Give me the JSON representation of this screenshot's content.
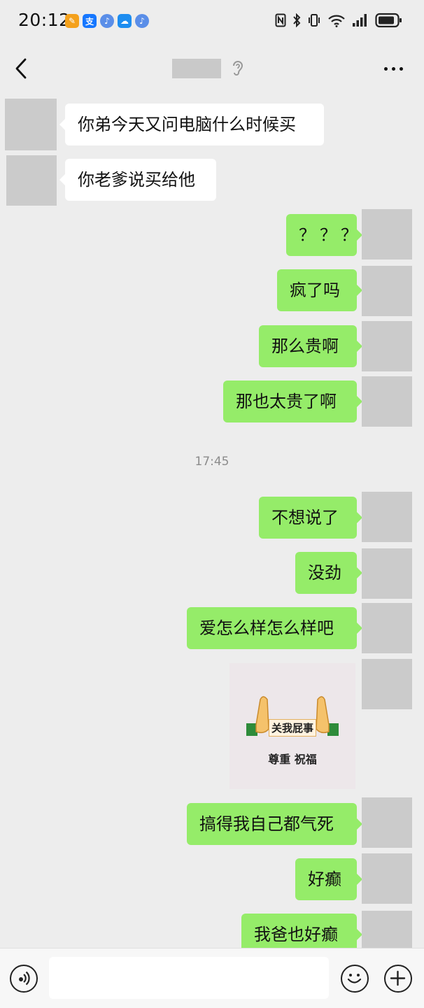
{
  "status_bar": {
    "time": "20:12",
    "app_icons": [
      "notes-app-icon",
      "alipay-icon",
      "music-app-icon",
      "weather-app-icon",
      "music-app-icon-2"
    ],
    "right_icons": [
      "nfc-icon",
      "bluetooth-icon",
      "vibrate-icon",
      "wifi-icon",
      "signal-icon",
      "battery-icon"
    ]
  },
  "header": {
    "back_icon": "chevron-left-icon",
    "listen_icon": "ear-icon",
    "more_icon": "more-horizontal-icon"
  },
  "messages": [
    {
      "side": "in",
      "text": "你弟今天又问电脑什么时候买"
    },
    {
      "side": "in",
      "text": "你老爹说买给他"
    },
    {
      "side": "out",
      "text": "？？？"
    },
    {
      "side": "out",
      "text": "疯了吗"
    },
    {
      "side": "out",
      "text": "那么贵啊"
    },
    {
      "side": "out",
      "text": "那也太贵了啊"
    },
    {
      "side": "out",
      "text": "不想说了"
    },
    {
      "side": "out",
      "text": "没劲"
    },
    {
      "side": "out",
      "text": "爱怎么样怎么样吧"
    },
    {
      "side": "out",
      "text": "搞得我自己都气死"
    },
    {
      "side": "out",
      "text": "好癫"
    },
    {
      "side": "out",
      "text": "我爸也好癫"
    }
  ],
  "timestamp": "17:45",
  "sticker": {
    "banner_text": "关我屁事",
    "caption": "尊重 祝福"
  },
  "input_bar": {
    "placeholder": "",
    "voice_icon": "voice-icon",
    "emoji_icon": "emoji-icon",
    "plus_icon": "plus-icon"
  },
  "colors": {
    "background": "#ededed",
    "outgoing_bubble": "#95ec69",
    "incoming_bubble": "#ffffff"
  }
}
